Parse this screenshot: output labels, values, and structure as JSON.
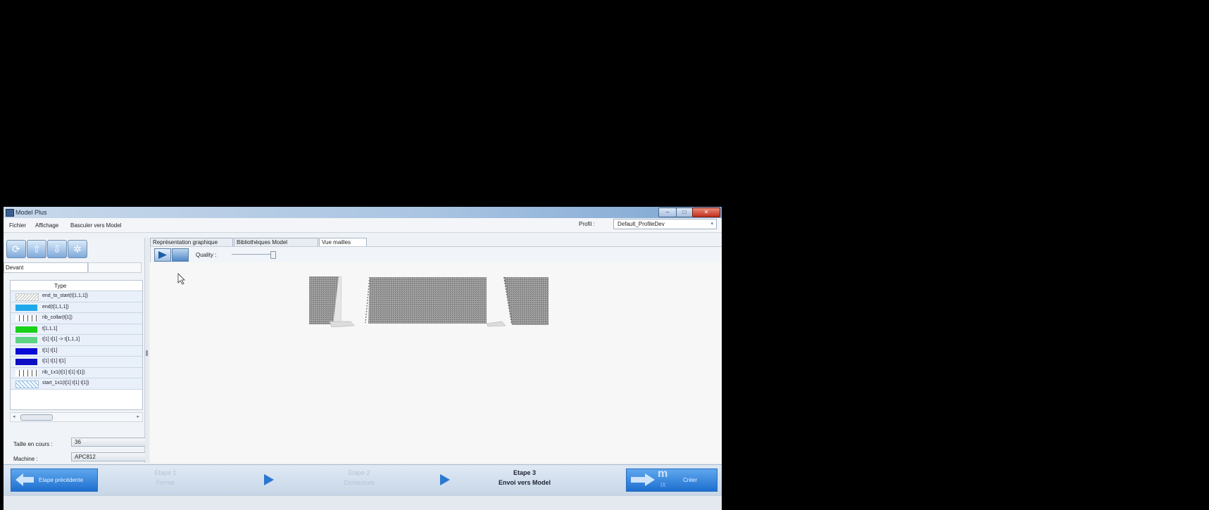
{
  "window": {
    "title": "Model Plus",
    "controls": {
      "minimize": "–",
      "maximize": "□",
      "close": "✕"
    }
  },
  "menu": {
    "items": [
      "Fichier",
      "Affichage",
      "Basculer vers Model"
    ],
    "profil_label": "Profil :",
    "profil_value": "Default_ProfileDev"
  },
  "toolbar": {
    "icons": [
      "refresh-icon",
      "upload-icon",
      "download-icon",
      "settings-icon"
    ]
  },
  "left": {
    "view_selector": "Devant",
    "type_header": "Type",
    "types": [
      {
        "label": "end_to_start(t[1,1,1])",
        "swatch": "hatched-gray"
      },
      {
        "label": "end(t[1,1,1])",
        "swatch": "#1fa9ea"
      },
      {
        "label": "rib_collar(t[1])",
        "swatch": "bars-gray"
      },
      {
        "label": "t[1,1,1]",
        "swatch": "#19d119"
      },
      {
        "label": "t[1] t[1] -> t[1,1,1]",
        "swatch": "#5dd383"
      },
      {
        "label": "t[1] t[1]",
        "swatch": "#0b0bd8"
      },
      {
        "label": "t[1] t[1] t[1]",
        "swatch": "#0d0dc4"
      },
      {
        "label": "rib_1x1(t[1] t[1] t[1])",
        "swatch": "bars-gray"
      },
      {
        "label": "start_1x1(t[1] t[1] t[1])",
        "swatch": "cross-blue"
      }
    ],
    "size_label": "Taille en cours :",
    "size_value": "36",
    "machine_label": "Machine :",
    "machine_value": "APC812"
  },
  "tabs": [
    "Représentation graphique",
    "Bibliothèques Model",
    "Vue mailles"
  ],
  "active_tab": 2,
  "playbar": {
    "quality_label": "Quality :",
    "quality_level": 0.95
  },
  "wizard": {
    "prev_label": "Etape précédente",
    "steps": [
      {
        "title": "Etape 1",
        "subtitle": "Forme",
        "state": "done"
      },
      {
        "title": "Etape 2",
        "subtitle": "Contexture",
        "state": "done"
      },
      {
        "title": "Etape 3",
        "subtitle": "Envoi vers Model",
        "state": "current"
      }
    ],
    "create_logo": "m",
    "create_sub": "IX",
    "create_label": "Créer"
  },
  "colors": {
    "accent": "#1d6fcf",
    "titlebar": "#a9c4e2",
    "knit_gray": "#8d8d8d"
  }
}
